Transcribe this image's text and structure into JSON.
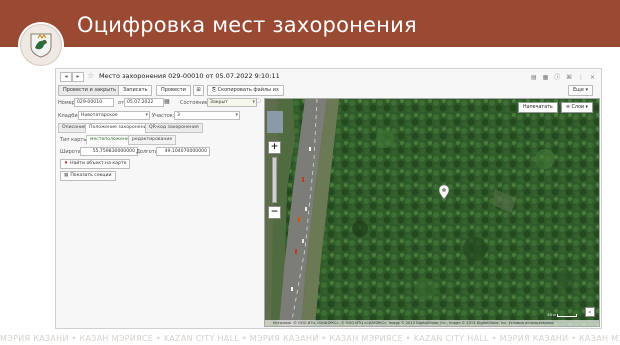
{
  "slide": {
    "title": "Оцифровка мест захоронения",
    "footer": "МЭРИЯ КАЗАНИ  •  КАЗАН МЭРИЯСЕ  •  KAZAN CITY HALL  •  МЭРИЯ КАЗАНИ  •  КАЗАН МЭРИЯСЕ  •  KAZAN CITY HALL  •  МЭРИЯ КАЗАНИ  •  КАЗАН МЭРИЯСЕ  •  KAZAN CITY HALL"
  },
  "window": {
    "title": "Место захоронения 029-00010 от 05.07.2022 9:10:11"
  },
  "toolbar": {
    "post_close": "Провести и закрыть",
    "save": "Записать",
    "post": "Провести",
    "copy_files": "Скопировать файлы из",
    "more": "Еще"
  },
  "form": {
    "number_label": "Номер:",
    "number_value": "029-00010",
    "date_label": "от:",
    "date_value": "05.07.2022",
    "state_label": "Состояние:",
    "state_value": "Закрыт",
    "cemetery_label": "Кладбище:",
    "cemetery_value": "Новотатарское",
    "plot_label": "Участок:",
    "plot_value": "3"
  },
  "tabs": [
    "Описание",
    "Положение захоронения",
    "QR-код захоронения"
  ],
  "subtabs": [
    "Тип карты:",
    "местоположение",
    "редактирование"
  ],
  "coords": {
    "lat_label": "Широта:",
    "lat_value": "55,759830000000",
    "lon_label": "Долгота:",
    "lon_value": "49,104070000000"
  },
  "buttons": {
    "find_object": "Найти объект на карте",
    "show_plots": "Показать секции"
  },
  "map": {
    "print_label": "Напечатать",
    "layers_label": "Слои",
    "scale_label": "50 м",
    "attribution": "Источник: © ООО ИТЦ «СКАНЭКС», © ООО ИТЦ «СКАНЭКС», Image © 2013 DigitalGlobe, Inc., Image © 2013 DigitalGlobe, Inc. Условия использования",
    "zoom_in": "+",
    "zoom_out": "−"
  },
  "colors": {
    "header": "#9a4a33",
    "forest": "#2f5a2a",
    "road": "#7d7d78"
  }
}
